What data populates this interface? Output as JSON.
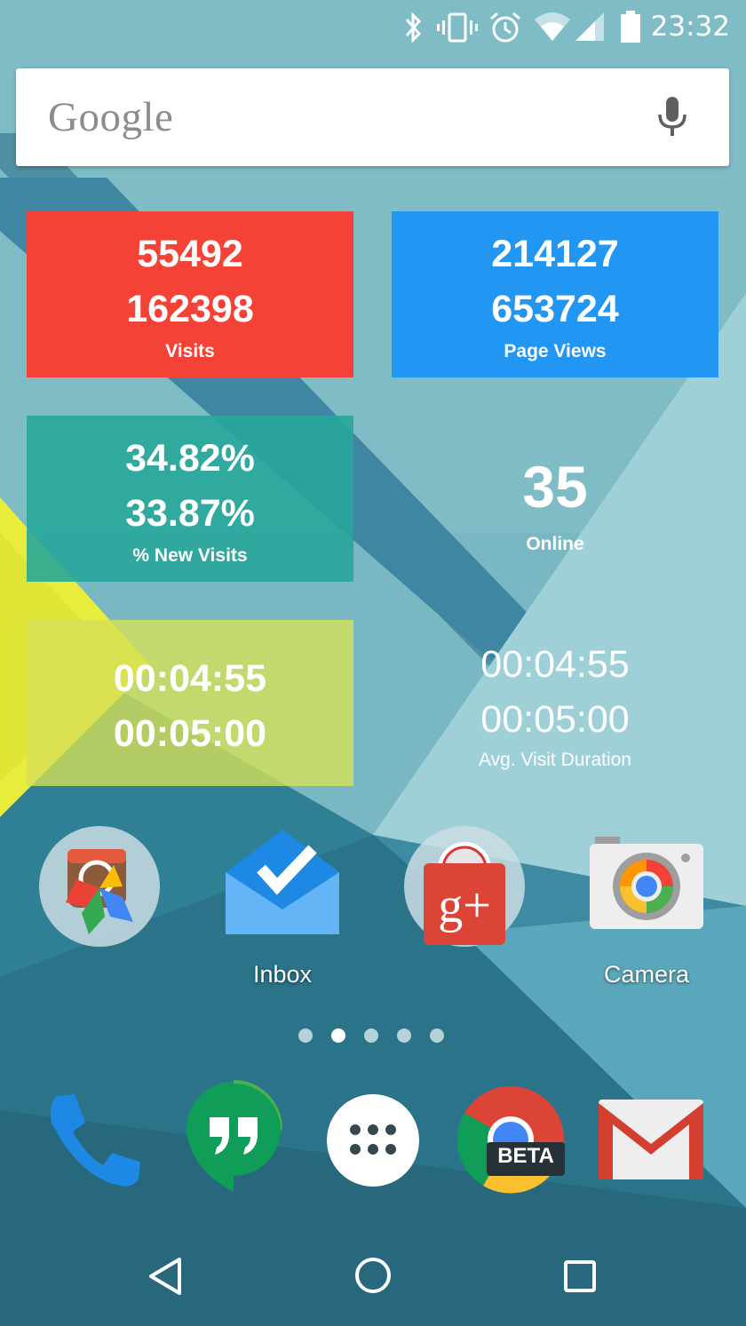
{
  "status_bar": {
    "time": "23:32",
    "icons": [
      "bluetooth-icon",
      "vibrate-icon",
      "alarm-icon",
      "wifi-icon",
      "signal-icon",
      "battery-icon"
    ]
  },
  "search": {
    "logo": "Google",
    "mic_icon": "mic-icon"
  },
  "widgets": [
    {
      "value1": "55492",
      "value2": "162398",
      "label": "Visits",
      "color": "#f44336"
    },
    {
      "value1": "214127",
      "value2": "653724",
      "label": "Page Views",
      "color": "#2196f3"
    },
    {
      "value1": "34.82%",
      "value2": "33.87%",
      "label": "% New Visits",
      "color": "#26a69a"
    },
    {
      "value": "35",
      "label": "Online"
    },
    {
      "value1": "00:04:55",
      "value2": "00:05:00",
      "color": "#d4e157"
    },
    {
      "value1": "00:04:55",
      "value2": "00:05:00",
      "label": "Avg. Visit Duration"
    }
  ],
  "apps": [
    {
      "name": "folder-icon",
      "label": ""
    },
    {
      "name": "inbox-icon",
      "label": "Inbox"
    },
    {
      "name": "google-plus-folder-icon",
      "label": ""
    },
    {
      "name": "camera-icon",
      "label": "Camera"
    }
  ],
  "page_indicator": {
    "count": 5,
    "active": 2
  },
  "dock": [
    "phone-icon",
    "hangouts-icon",
    "app-drawer-icon",
    "chrome-beta-icon",
    "gmail-icon"
  ],
  "chrome_badge": "BETA",
  "navbar": [
    "back-icon",
    "home-icon",
    "recents-icon"
  ]
}
